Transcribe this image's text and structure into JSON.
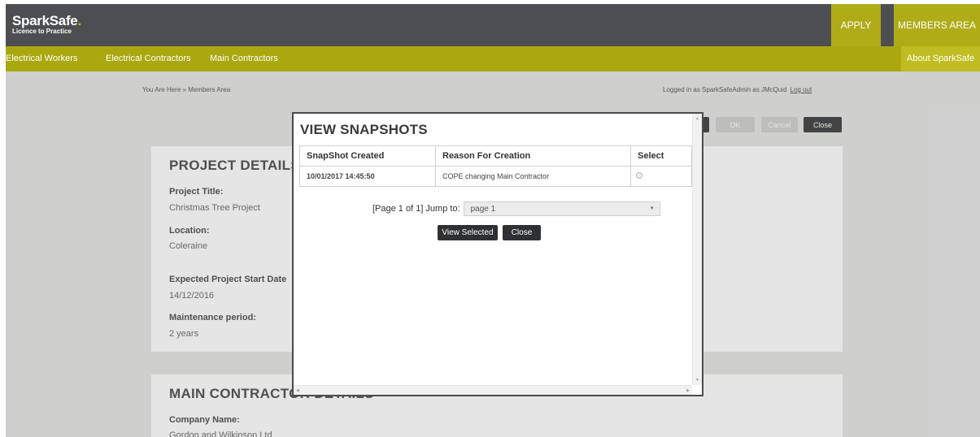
{
  "header": {
    "logo_name": "SparkSafe",
    "logo_dot": ".",
    "logo_tagline": "Licence to Practice",
    "apply_label": "APPLY",
    "members_label": "MEMBERS AREA"
  },
  "nav": {
    "items": [
      "Electrical Workers",
      "Electrical Contractors",
      "Main Contractors"
    ],
    "right_item": "About SparkSafe"
  },
  "breadcrumb": "You Are Here » Members Area",
  "login": {
    "text": "Logged in as SparkSafeAdmin as JMcQuid",
    "logout_label": "Log out"
  },
  "page_buttons": {
    "ok": "OK",
    "cancel": "Cancel",
    "close": "Close"
  },
  "project_details": {
    "title": "PROJECT DETAILS",
    "fields": [
      {
        "label": "Project Title:",
        "value": "Christmas Tree Project"
      },
      {
        "label": "Location:",
        "value": "Coleraine"
      },
      {
        "label": "Expected Project Start Date",
        "value": "14/12/2016"
      },
      {
        "label": "Maintenance period:",
        "value": "2 years"
      }
    ]
  },
  "main_contractor": {
    "title": "MAIN CONTRACTOR DETAILS",
    "fields": [
      {
        "label": "Company Name:",
        "value": "Gordon and Wilkinson Ltd"
      }
    ]
  },
  "modal": {
    "title": "VIEW SNAPSHOTS",
    "columns": [
      "SnapShot Created",
      "Reason For Creation",
      "Select"
    ],
    "rows": [
      {
        "created": "10/01/2017 14:45:50",
        "reason": "COPE changing Main Contractor",
        "selected": false
      }
    ],
    "pager_text": "[Page 1 of 1] Jump to:",
    "jump_selected": "page 1",
    "view_selected_label": "View Selected",
    "close_label": "Close"
  },
  "colors": {
    "header_bg": "#4c4e51",
    "accent_olive": "#aaa80f",
    "button_dark": "#2f3033"
  }
}
